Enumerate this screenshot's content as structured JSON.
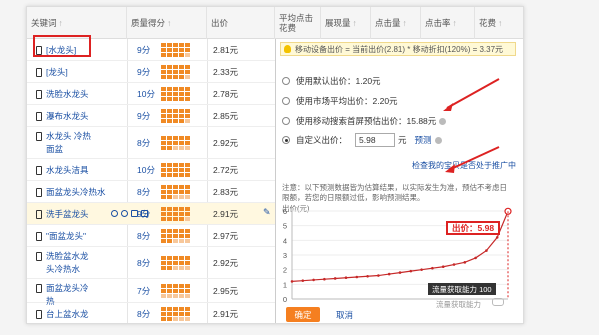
{
  "header": {
    "col_keyword": "关键词",
    "col_quality": "质量得分",
    "col_bid": "出价",
    "col_avg_cpc": "平均点击花费",
    "col_impressions": "展现量",
    "col_clicks": "点击量",
    "col_ctr": "点击率",
    "col_cost": "花费",
    "sort_glyph": "↑"
  },
  "rows": [
    {
      "keyword": "[水龙头]",
      "score": "9分",
      "price": "2.81元",
      "bars": 14
    },
    {
      "keyword": "[龙头]",
      "score": "9分",
      "price": "2.33元",
      "bars": 14
    },
    {
      "keyword": "洗脸水龙头",
      "score": "10分",
      "price": "2.78元",
      "bars": 15
    },
    {
      "keyword": "瀑布水龙头",
      "score": "9分",
      "price": "2.85元",
      "bars": 14
    },
    {
      "keyword": "水龙头 冷热\n面盆",
      "score": "8分",
      "price": "2.92元",
      "bars": 12
    },
    {
      "keyword": "水龙头洁具",
      "score": "10分",
      "price": "2.72元",
      "bars": 15
    },
    {
      "keyword": "面盆龙头冷热水",
      "score": "8分",
      "price": "2.83元",
      "bars": 12
    },
    {
      "keyword": "洗手盆龙头",
      "score": "9分",
      "price": "2.91元",
      "bars": 14
    },
    {
      "keyword": "\"面盆龙头\"",
      "score": "8分",
      "price": "2.97元",
      "bars": 12
    },
    {
      "keyword": "洗脸盆水龙\n头冷热水",
      "score": "8分",
      "price": "2.92元",
      "bars": 12
    },
    {
      "keyword": "面盆龙头冷\n热",
      "score": "7分",
      "price": "2.95元",
      "bars": 10
    },
    {
      "keyword": "台上盆水龙",
      "score": "8分",
      "price": "2.91元",
      "bars": 12
    }
  ],
  "popup": {
    "tip": "移动设备出价 = 当前出价(2.81) * 移动折扣(120%) = 3.37元",
    "option_default": "使用默认出价：1.20元",
    "option_market": "使用市场平均出价：2.20元",
    "option_mobile_first": "使用移动搜索首屏预估出价：15.88元",
    "option_custom": "自定义出价：",
    "custom_value": "5.98",
    "custom_unit": "元",
    "preview_link": "预测",
    "check_link": "检查我的宝贝是否处于推广中",
    "note": "注意：以下预测数据皆为估算结果，以实际发生为准，预估不考虑日限额，若您的日限额过低，影响预测结果。",
    "yaxis_label": "出价(元)",
    "bid_tag": "出价：5.98",
    "capability_label": "流量获取能力 100",
    "hint_label": "流量获取能力",
    "ok_button": "确定",
    "cancel_button": "取消"
  },
  "chart_data": {
    "type": "line",
    "ylabel": "出价(元)",
    "ylim": [
      0,
      6
    ],
    "y_ticks": [
      0,
      1,
      2,
      3,
      4,
      5,
      6
    ],
    "x": [
      0,
      5,
      10,
      15,
      20,
      25,
      30,
      35,
      40,
      45,
      50,
      55,
      60,
      65,
      70,
      75,
      80,
      85,
      90,
      95,
      100
    ],
    "series": [
      {
        "values": [
          1.2,
          1.25,
          1.3,
          1.35,
          1.4,
          1.45,
          1.5,
          1.55,
          1.6,
          1.7,
          1.8,
          1.9,
          2.0,
          2.1,
          2.2,
          2.35,
          2.5,
          2.8,
          3.3,
          4.2,
          5.98
        ]
      }
    ]
  },
  "colors": {
    "accent": "#f57f20",
    "link": "#1a4fa3",
    "red": "#d22222",
    "bar": "#f08a24"
  }
}
